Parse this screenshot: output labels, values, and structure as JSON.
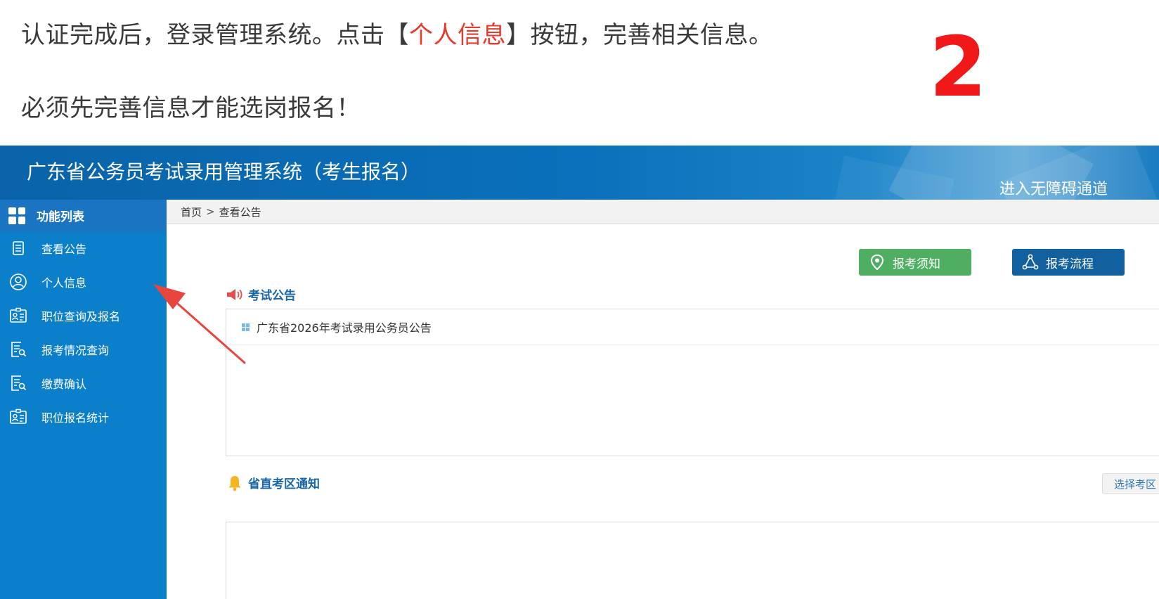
{
  "caption": {
    "line1_pre": "认证完成后，登录管理系统。点击【",
    "line1_highlight": "个人信息",
    "line1_post": "】按钮，完善相关信息。",
    "line2": "必须先完善信息才能选岗报名！",
    "step_number": "2"
  },
  "header": {
    "title": "广东省公务员考试录用管理系统（考生报名）",
    "accessibility_link": "进入无障碍通道"
  },
  "sidebar": {
    "heading": "功能列表",
    "items": [
      {
        "label": "查看公告",
        "icon": "document-list-icon"
      },
      {
        "label": "个人信息",
        "icon": "user-circle-icon"
      },
      {
        "label": "职位查询及报名",
        "icon": "id-card-icon"
      },
      {
        "label": "报考情况查询",
        "icon": "document-search-icon"
      },
      {
        "label": "缴费确认",
        "icon": "document-search-icon"
      },
      {
        "label": "职位报名统计",
        "icon": "id-card-icon"
      }
    ]
  },
  "breadcrumb": {
    "home": "首页",
    "separator": ">",
    "current": "查看公告"
  },
  "buttons": {
    "notice": "报考须知",
    "process": "报考流程"
  },
  "exam_announcements": {
    "title": "考试公告",
    "items": [
      "广东省2026年考试录用公务员公告"
    ]
  },
  "provincial_notices": {
    "title": "省直考区通知",
    "select_zone": "选择考区"
  },
  "colors": {
    "sidebar": "#0c7fcb",
    "header": "#0a63a8",
    "notice_button": "#4fae62",
    "process_button": "#12609e",
    "highlight": "#e8392b",
    "step_number": "#f01818",
    "annotation_arrow": "#e9453f"
  }
}
